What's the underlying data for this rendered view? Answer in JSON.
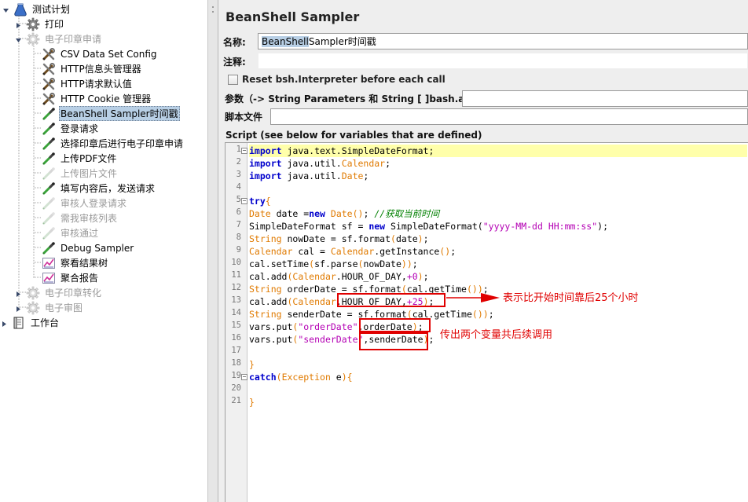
{
  "tree": {
    "root": {
      "label": "测试计划",
      "icon": "testplan-icon"
    },
    "items": [
      {
        "label": "打印",
        "icon": "gear-icon",
        "disabled": false
      },
      {
        "label": "电子印章申请",
        "icon": "gear-icon",
        "disabled": true
      },
      {
        "label": "CSV Data Set Config",
        "icon": "config-wrench-icon",
        "disabled": false
      },
      {
        "label": "HTTP信息头管理器",
        "icon": "config-wrench-icon",
        "disabled": false
      },
      {
        "label": "HTTP请求默认值",
        "icon": "config-wrench-icon",
        "disabled": false
      },
      {
        "label": "HTTP Cookie 管理器",
        "icon": "config-wrench-icon",
        "disabled": false
      },
      {
        "label": "BeanShell Sampler时间戳",
        "icon": "sampler-pipette-icon",
        "disabled": false,
        "selected": true
      },
      {
        "label": "登录请求",
        "icon": "sampler-pipette-icon",
        "disabled": false
      },
      {
        "label": "选择印章后进行电子印章申请",
        "icon": "sampler-pipette-icon",
        "disabled": false
      },
      {
        "label": "上传PDF文件",
        "icon": "sampler-pipette-icon",
        "disabled": false
      },
      {
        "label": "上传图片文件",
        "icon": "sampler-pipette-icon",
        "disabled": true
      },
      {
        "label": "填写内容后，发送请求",
        "icon": "sampler-pipette-icon",
        "disabled": false
      },
      {
        "label": "审核人登录请求",
        "icon": "sampler-pipette-icon",
        "disabled": true
      },
      {
        "label": "需我审核列表",
        "icon": "sampler-pipette-icon",
        "disabled": true
      },
      {
        "label": "审核通过",
        "icon": "sampler-pipette-icon",
        "disabled": true
      },
      {
        "label": "Debug Sampler",
        "icon": "sampler-pipette-icon",
        "disabled": false
      },
      {
        "label": "察看结果树",
        "icon": "listener-chart-icon",
        "disabled": false
      },
      {
        "label": "聚合报告",
        "icon": "listener-chart-icon",
        "disabled": false
      },
      {
        "label": "电子印章转化",
        "icon": "gear-icon",
        "disabled": true
      },
      {
        "label": "电子审图",
        "icon": "gear-icon",
        "disabled": true
      }
    ],
    "workbench": {
      "label": "工作台",
      "icon": "workbench-icon"
    }
  },
  "panel": {
    "title": "BeanShell Sampler",
    "name_label": "名称:",
    "name_value_sel": "BeanShell",
    "name_value_rest": " Sampler时间戳",
    "comment_label": "注释:",
    "comment_value": "",
    "reset_label": "Reset bsh.Interpreter before each call",
    "reset_checked": false,
    "params_label": "参数（-> String Parameters 和 String [ ]bash.args）",
    "params_value": "",
    "file_label": "脚本文件",
    "file_value": "",
    "script_label": "Script (see below for variables that are defined)"
  },
  "editor": {
    "line_numbers": [
      "1",
      "2",
      "3",
      "4",
      "5",
      "6",
      "7",
      "8",
      "9",
      "10",
      "11",
      "12",
      "13",
      "14",
      "15",
      "16",
      "17",
      "18",
      "19",
      "20",
      "21"
    ],
    "lines": [
      [
        [
          "kw",
          "import"
        ],
        [
          "cl",
          " java.text.SimpleDateFormat;"
        ]
      ],
      [
        [
          "kw",
          "import"
        ],
        [
          "cl",
          " java.util."
        ],
        [
          "ty",
          "Calendar"
        ],
        [
          "cl",
          ";"
        ]
      ],
      [
        [
          "kw",
          "import"
        ],
        [
          "cl",
          " java.util."
        ],
        [
          "ty",
          "Date"
        ],
        [
          "cl",
          ";"
        ]
      ],
      [],
      [
        [
          "kw",
          "try"
        ],
        [
          "ty",
          "{"
        ]
      ],
      [
        [
          "ty",
          "Date"
        ],
        [
          "cl",
          " date ="
        ],
        [
          "kw",
          "new"
        ],
        [
          "cl",
          " "
        ],
        [
          "ty",
          "Date"
        ],
        [
          "ty",
          "()"
        ],
        [
          "cl",
          "; "
        ],
        [
          "cm",
          "//获取当前时间"
        ]
      ],
      [
        [
          "cl",
          "SimpleDateFormat sf = "
        ],
        [
          "kw",
          "new"
        ],
        [
          "cl",
          " SimpleDateFormat("
        ],
        [
          "str",
          "\"yyyy-MM-dd HH:mm:ss\""
        ],
        [
          "cl",
          ");"
        ]
      ],
      [
        [
          "ty",
          "String"
        ],
        [
          "cl",
          " nowDate = sf.format"
        ],
        [
          "ty",
          "("
        ],
        [
          "cl",
          "date"
        ],
        [
          "ty",
          ")"
        ],
        [
          "cl",
          ";"
        ]
      ],
      [
        [
          "ty",
          "Calendar"
        ],
        [
          "cl",
          " cal = "
        ],
        [
          "ty",
          "Calendar"
        ],
        [
          "cl",
          ".getInstance"
        ],
        [
          "ty",
          "()"
        ],
        [
          "cl",
          ";"
        ]
      ],
      [
        [
          "cl",
          "cal.setTime"
        ],
        [
          "ty",
          "("
        ],
        [
          "cl",
          "sf.parse"
        ],
        [
          "ty",
          "("
        ],
        [
          "cl",
          "nowDate"
        ],
        [
          "ty",
          "))"
        ],
        [
          "cl",
          ";"
        ]
      ],
      [
        [
          "cl",
          "cal.add"
        ],
        [
          "ty",
          "("
        ],
        [
          "ty",
          "Calendar"
        ],
        [
          "cl",
          ".HOUR_OF_DAY,"
        ],
        [
          "str",
          "+0"
        ],
        [
          "ty",
          ")"
        ],
        [
          "cl",
          ";"
        ]
      ],
      [
        [
          "ty",
          "String"
        ],
        [
          "cl",
          " orderDate = sf.format"
        ],
        [
          "ty",
          "("
        ],
        [
          "cl",
          "cal.getTime"
        ],
        [
          "ty",
          "())"
        ],
        [
          "cl",
          ";"
        ]
      ],
      [
        [
          "cl",
          "cal.add"
        ],
        [
          "ty",
          "("
        ],
        [
          "ty",
          "Calendar"
        ],
        [
          "cl",
          ".HOUR_OF_DAY,"
        ],
        [
          "str",
          "+25"
        ],
        [
          "ty",
          ")"
        ],
        [
          "cl",
          ";"
        ]
      ],
      [
        [
          "ty",
          "String"
        ],
        [
          "cl",
          " senderDate = sf.format"
        ],
        [
          "ty",
          "("
        ],
        [
          "cl",
          "cal.getTime"
        ],
        [
          "ty",
          "())"
        ],
        [
          "cl",
          ";"
        ]
      ],
      [
        [
          "cl",
          "vars.put"
        ],
        [
          "ty",
          "("
        ],
        [
          "str",
          "\"orderDate\""
        ],
        [
          "cl",
          ",orderDate"
        ],
        [
          "ty",
          ")"
        ],
        [
          "cl",
          ";"
        ]
      ],
      [
        [
          "cl",
          "vars.put"
        ],
        [
          "ty",
          "("
        ],
        [
          "str",
          "\"senderDate\""
        ],
        [
          "cl",
          ",senderDate"
        ],
        [
          "ty",
          ")"
        ],
        [
          "cl",
          ";"
        ]
      ],
      [],
      [
        [
          "ty",
          "}"
        ]
      ],
      [
        [
          "kw",
          "catch"
        ],
        [
          "ty",
          "("
        ],
        [
          "ty",
          "Exception"
        ],
        [
          "cl",
          " e"
        ],
        [
          "ty",
          ")"
        ],
        [
          "ty",
          "{"
        ]
      ],
      [],
      [
        [
          "ty",
          "}"
        ]
      ]
    ],
    "fold_lines": [
      1,
      5,
      19
    ],
    "current_line": 1
  },
  "annotations": {
    "note1": "表示比开始时间靠后25个小时",
    "note2": "传出两个变量共后续调用",
    "color": "#e00000"
  },
  "colors": {
    "selection": "#b8cfe5",
    "keyword": "#0000cc",
    "type": "#e07a00",
    "string": "#b400b4",
    "comment": "#008000",
    "current_line": "#ffffaa"
  }
}
